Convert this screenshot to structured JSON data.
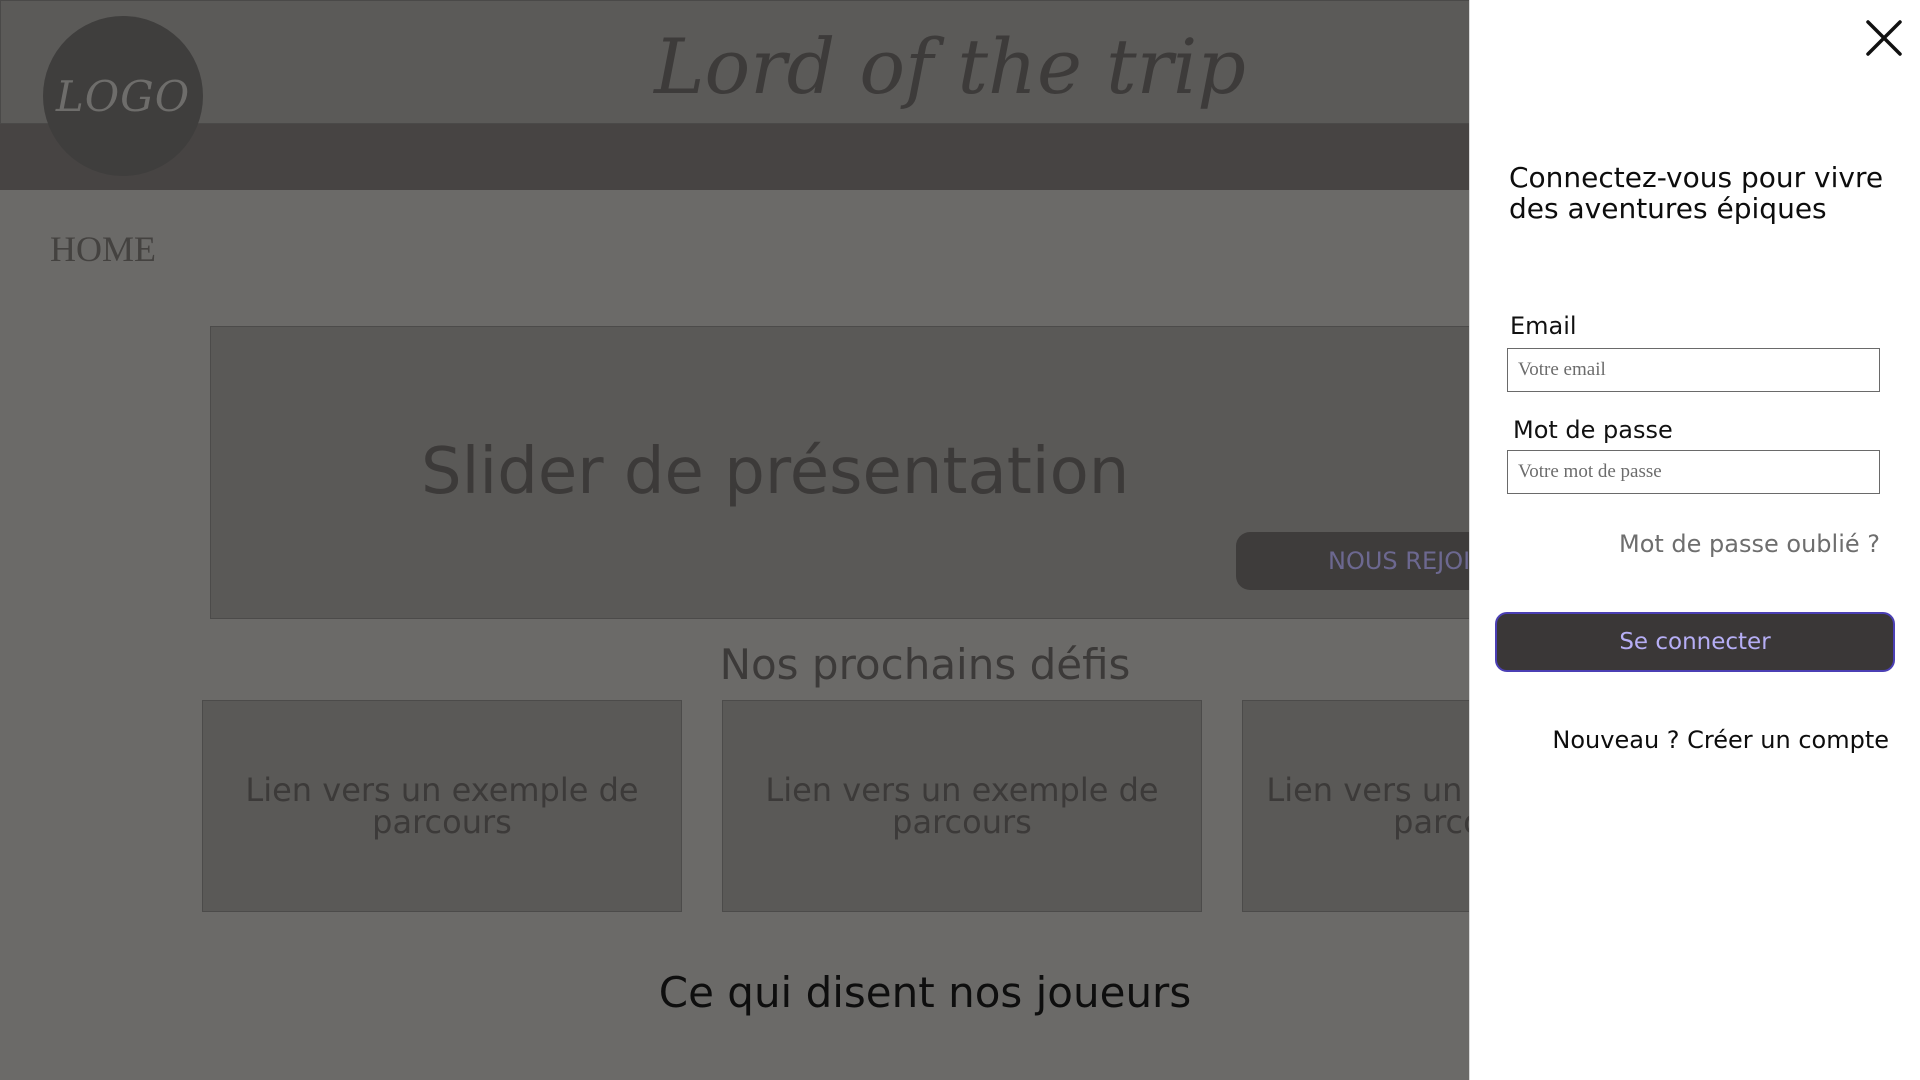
{
  "site": {
    "logo_text": "LOGO",
    "title": "Lord of the trip"
  },
  "nav": {
    "home": "HOME"
  },
  "slider": {
    "title": "Slider de présentation",
    "join_button": "NOUS REJOINDRE"
  },
  "challenges": {
    "title": "Nos prochains défis",
    "cards": [
      "Lien vers un exemple de parcours",
      "Lien vers un exemple de parcours",
      "Lien vers un exemple de parcours"
    ]
  },
  "testimonials": {
    "title": "Ce qui disent nos joueurs"
  },
  "login_panel": {
    "heading": "Connectez-vous pour vivre des aventures épiques",
    "email_label": "Email",
    "email_placeholder": "Votre email",
    "password_label": "Mot de passe",
    "password_placeholder": "Votre mot de passe",
    "forgot_link": "Mot de passe oublié ?",
    "submit_button": "Se connecter",
    "signup_link": "Nouveau ? Créer un compte",
    "close_icon": "close-icon"
  },
  "colors": {
    "overlay_bg": "#6b6a68",
    "panel_bg": "#ffffff",
    "button_bg": "#3a3737",
    "button_border": "#4b3fb4",
    "button_text": "#b6aef5"
  }
}
